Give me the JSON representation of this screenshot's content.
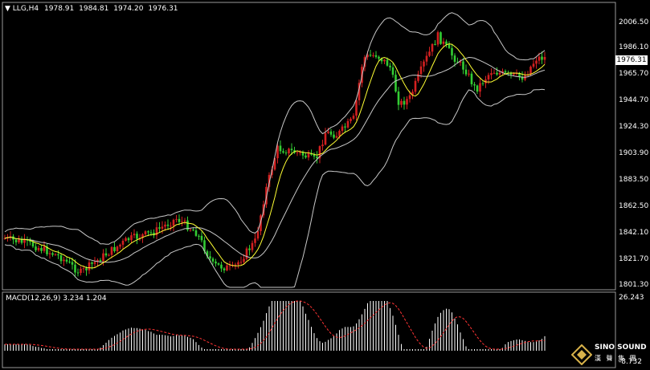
{
  "header": {
    "symbol": "LLG,H4",
    "open": "1978.91",
    "high": "1984.81",
    "low": "1974.20",
    "close": "1976.31"
  },
  "price_axis": {
    "ticks": [
      "2006.50",
      "1986.10",
      "1965.70",
      "1944.70",
      "1924.30",
      "1903.90",
      "1883.50",
      "1862.50",
      "1842.10",
      "1821.70",
      "1801.30"
    ],
    "current": "1976.31"
  },
  "macd": {
    "label": "MACD(12,26,9) 3.234 1.204",
    "axis_top": "26.243",
    "axis_bottom": "-8.732"
  },
  "watermark": {
    "name": "SINO SOUND",
    "chinese": "漢 聲 集 團"
  },
  "colors": {
    "bull": "#d42020",
    "bear": "#33cc33",
    "ma": "#ffff33",
    "bands": "#c8c8c8",
    "signal": "#ff3333",
    "histogram": "#ffffff"
  }
}
